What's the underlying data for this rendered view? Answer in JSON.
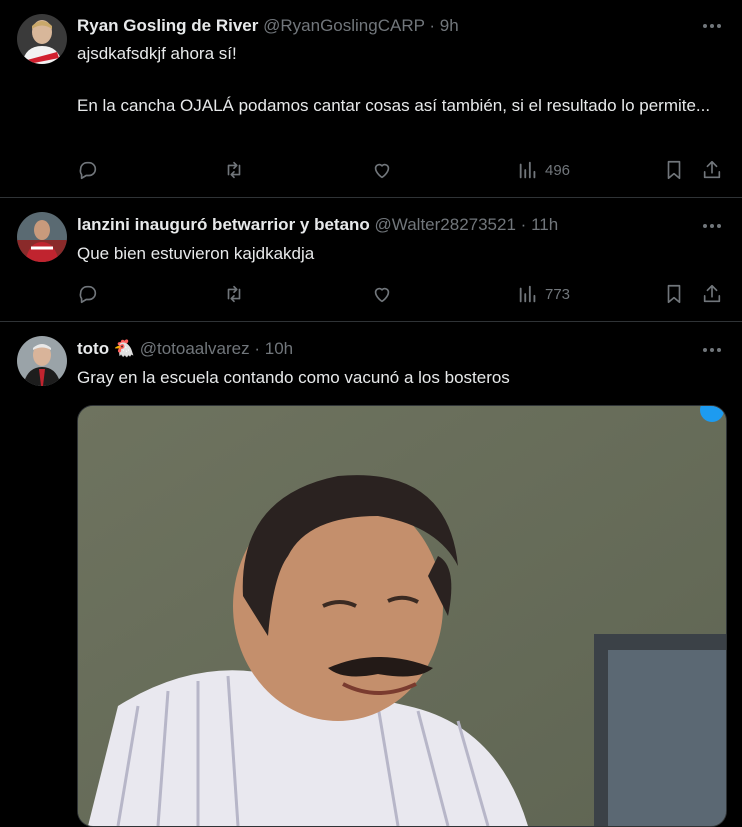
{
  "tweets": [
    {
      "name": "Ryan Gosling de River",
      "handle": "@RyanGoslingCARP",
      "sep": "·",
      "time": "9h",
      "lines": [
        "ajsdkafsdkjf ahora sí!",
        "En la cancha OJALÁ podamos cantar cosas así también, si el resultado lo permite..."
      ],
      "views": "496"
    },
    {
      "name": "lanzini inauguró betwarrior y betano",
      "handle": "@Walter28273521",
      "sep": "·",
      "time": "11h",
      "lines": [
        "Que bien estuvieron kajdkakdja"
      ],
      "views": "773"
    },
    {
      "name": "toto",
      "emoji": "🐔",
      "handle": "@totoaalvarez",
      "sep": "·",
      "time": "10h",
      "lines": [
        "Gray en la escuela contando como vacunó a los bosteros"
      ]
    }
  ],
  "icons": {
    "more": "more-horizontal-icon",
    "reply": "reply-icon",
    "retweet": "retweet-icon",
    "like": "heart-icon",
    "views": "views-chart-icon",
    "bookmark": "bookmark-icon",
    "share": "share-icon"
  },
  "colors": {
    "background": "#000000",
    "text": "#e7e9ea",
    "muted": "#71767b",
    "divider": "#2f3336"
  }
}
